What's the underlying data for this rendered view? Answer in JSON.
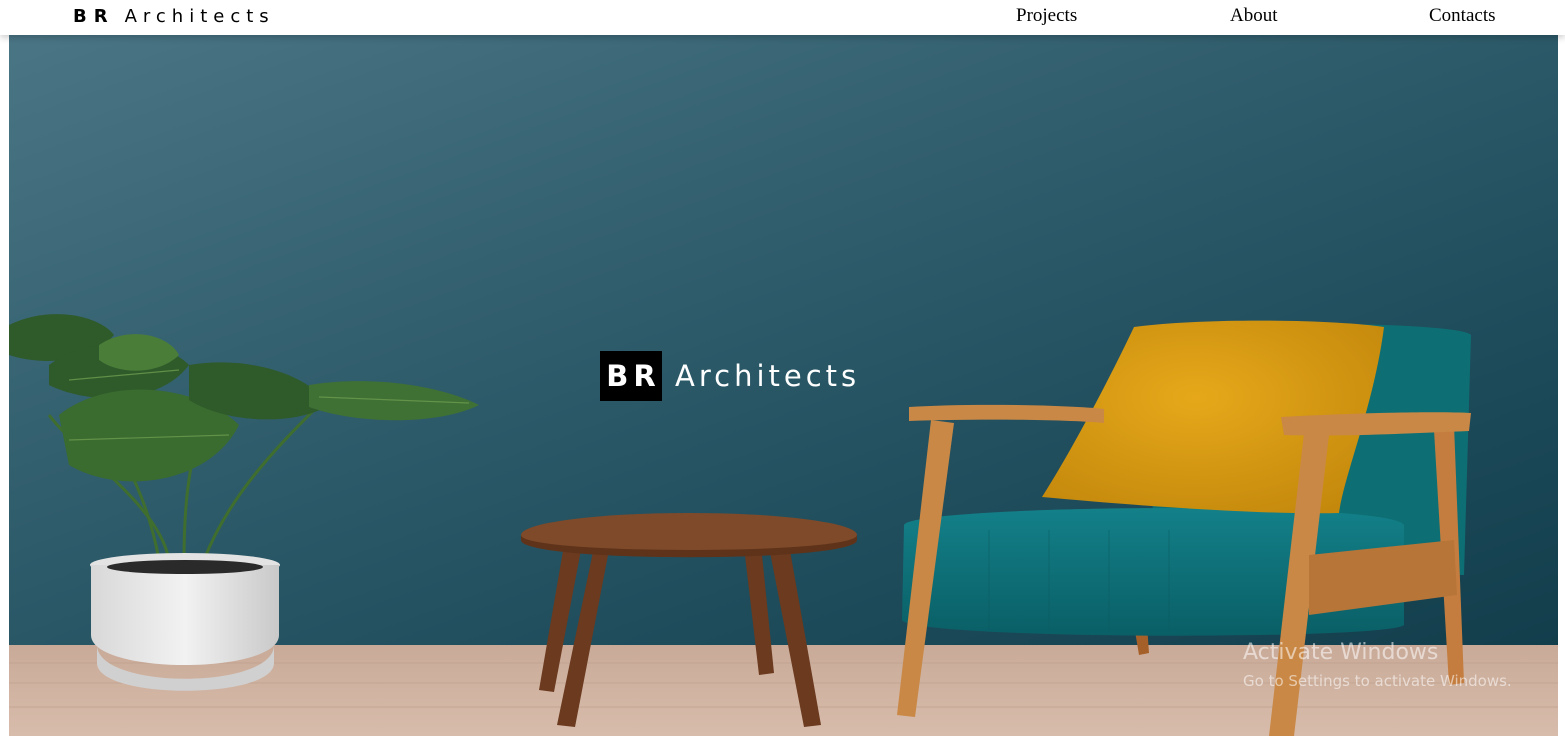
{
  "nav": {
    "brand_bold": "BR",
    "brand_rest": "Architects",
    "links": [
      "Projects",
      "About",
      "Contacts"
    ]
  },
  "hero": {
    "logo_box": "BR",
    "logo_word": "Architects",
    "image_alt": "Living room with teal wall, potted monstera plant, wooden side table and teal armchair with mustard pillow"
  },
  "watermark": {
    "title": "Activate Windows",
    "subtitle": "Go to Settings to activate Windows."
  },
  "colors": {
    "wall": "#2a5867",
    "floor": "#d4b6a4",
    "chair": "#0f7378",
    "pillow": "#d99a12",
    "wood": "#c07a3c",
    "table": "#7a4426"
  }
}
